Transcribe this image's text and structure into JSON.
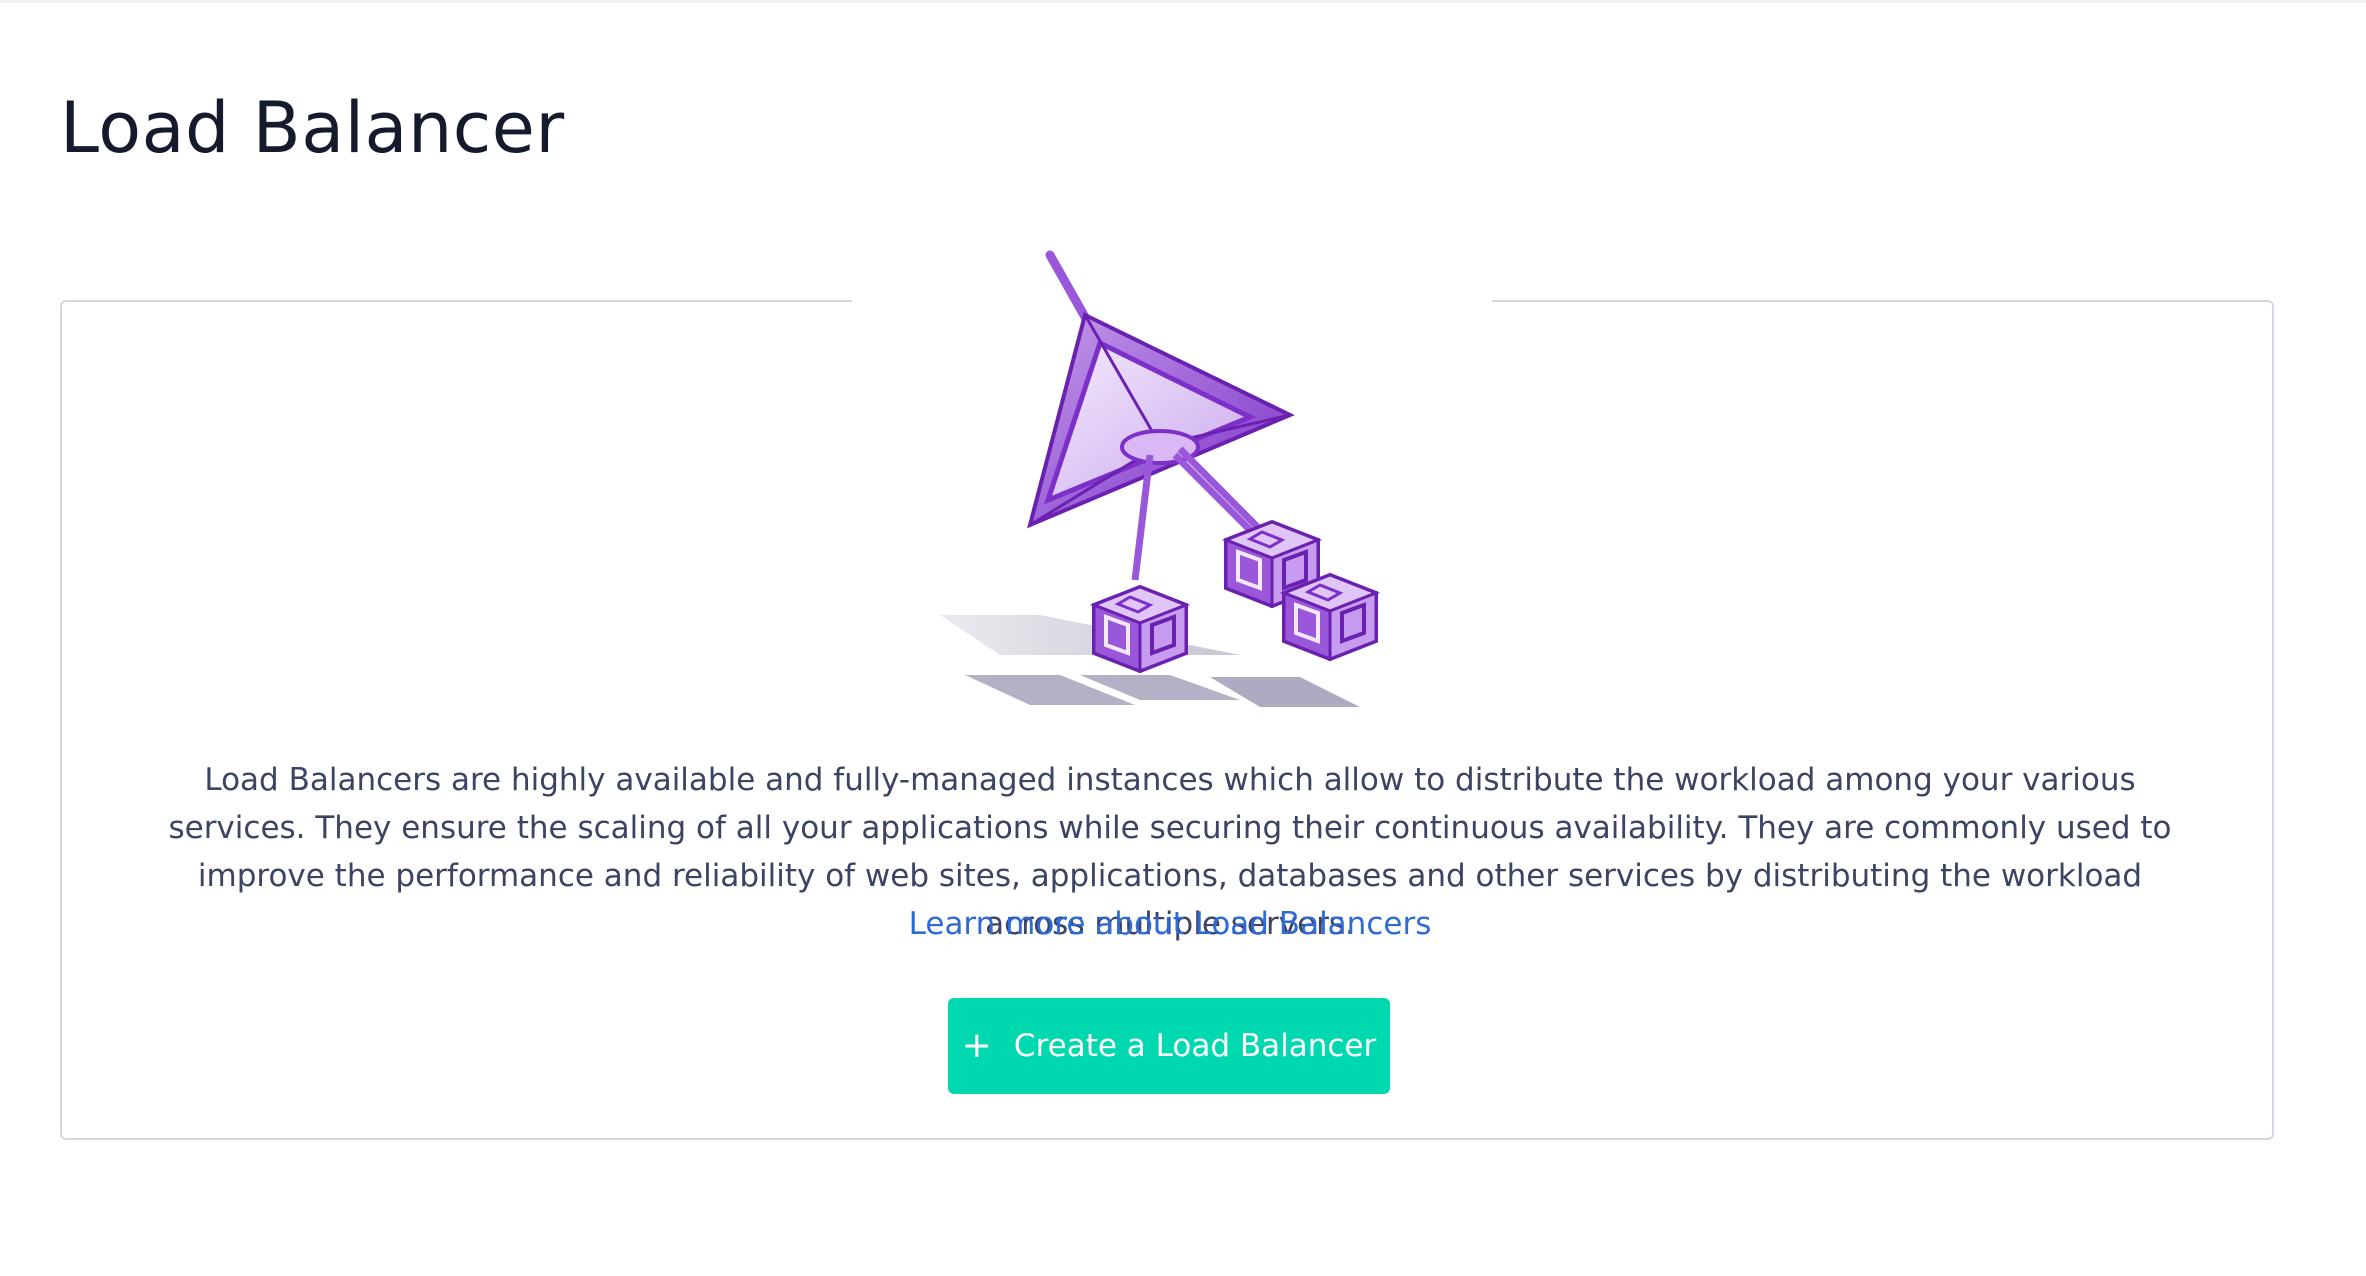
{
  "page": {
    "title": "Load Balancer"
  },
  "empty_state": {
    "illustration_icon": "load-balancer-illustration",
    "description": "Load Balancers are highly available and fully-managed instances which allow to distribute the workload among your various services. They ensure the scaling of all your applications while securing their continuous availability. They are commonly used to improve the performance and reliability of web sites, applications, databases and other services by distributing the workload across multiple servers.",
    "learn_more_label": "Learn more about Load Balancers",
    "create_button": {
      "icon": "plus-icon",
      "icon_glyph": "+",
      "label": "Create a Load Balancer"
    }
  },
  "colors": {
    "title": "#151a2d",
    "body_text": "#3d4463",
    "link": "#2f6bd6",
    "primary_button": "#00d9b0",
    "illustration_accent": "#8b3fd1"
  }
}
